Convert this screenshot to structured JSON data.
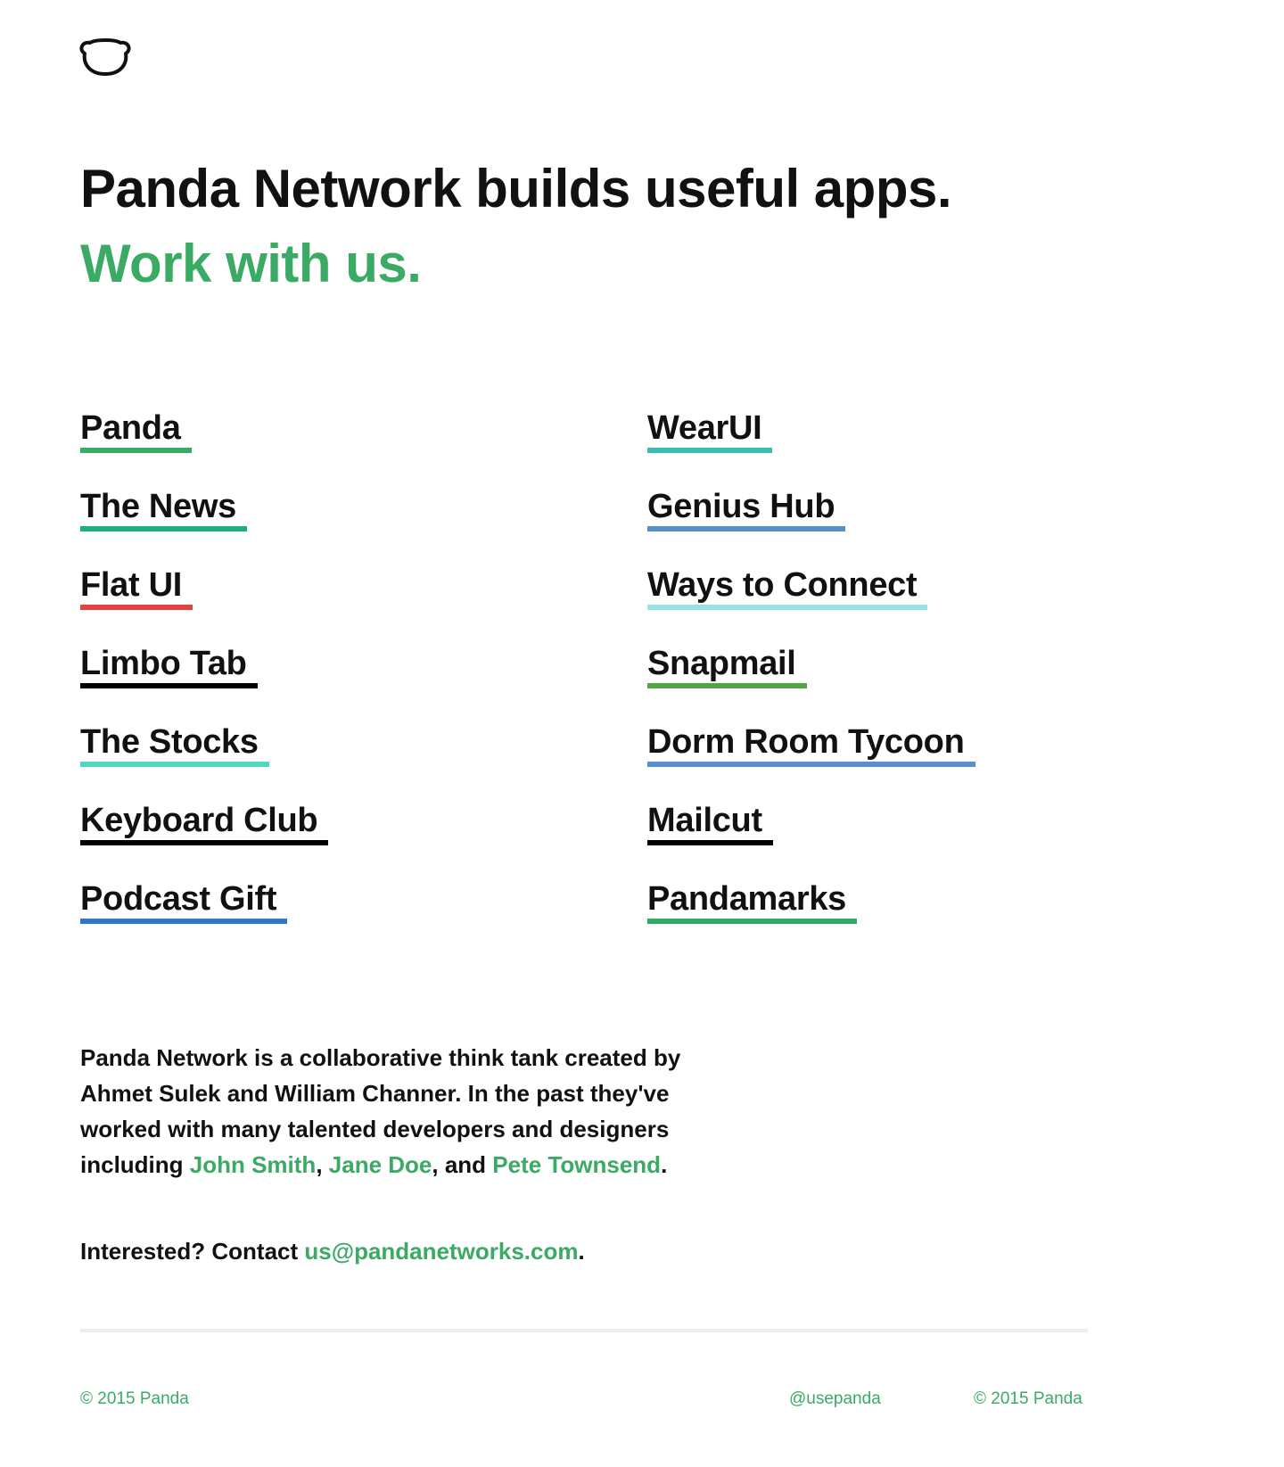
{
  "logo": {
    "icon": "panda-icon"
  },
  "hero": {
    "headline": "Panda Network builds useful apps.",
    "subhead": "Work with us."
  },
  "apps": {
    "left": [
      {
        "label": "Panda",
        "underline": "#3aaa64"
      },
      {
        "label": "The News",
        "underline": "#1fae84"
      },
      {
        "label": "Flat UI",
        "underline": "#e0463f"
      },
      {
        "label": "Limbo Tab",
        "underline": "#000000"
      },
      {
        "label": "The Stocks",
        "underline": "#4fd8bd"
      },
      {
        "label": "Keyboard Club",
        "underline": "#000000"
      },
      {
        "label": "Podcast Gift",
        "underline": "#2f78c4"
      }
    ],
    "right": [
      {
        "label": "WearUI",
        "underline": "#3dbcb5"
      },
      {
        "label": "Genius Hub",
        "underline": "#5a8fc6"
      },
      {
        "label": "Ways to Connect",
        "underline": "#97e5e0"
      },
      {
        "label": "Snapmail",
        "underline": "#52a447"
      },
      {
        "label": "Dorm Room Tycoon",
        "underline": "#5a8fcf"
      },
      {
        "label": "Mailcut",
        "underline": "#000000"
      },
      {
        "label": "Pandamarks",
        "underline": "#34a867"
      }
    ]
  },
  "about": {
    "text_1": "Panda Network is a collaborative think tank created by Ahmet Sulek and William Channer.  In the past they've worked with many talented developers and designers including ",
    "person_1": "John Smith",
    "sep_1": ", ",
    "person_2": "Jane Doe",
    "sep_2": ", and ",
    "person_3": "Pete Townsend",
    "end": "."
  },
  "contact": {
    "prefix": "Interested? Contact ",
    "email": "us@pandanetworks.com",
    "end": "."
  },
  "footer": {
    "left": "© 2015 Panda",
    "twitter": "@usepanda",
    "right": "© 2015 Panda"
  },
  "colors": {
    "accent": "#3aaa64",
    "text": "#111111",
    "divider": "#eeeeee"
  }
}
